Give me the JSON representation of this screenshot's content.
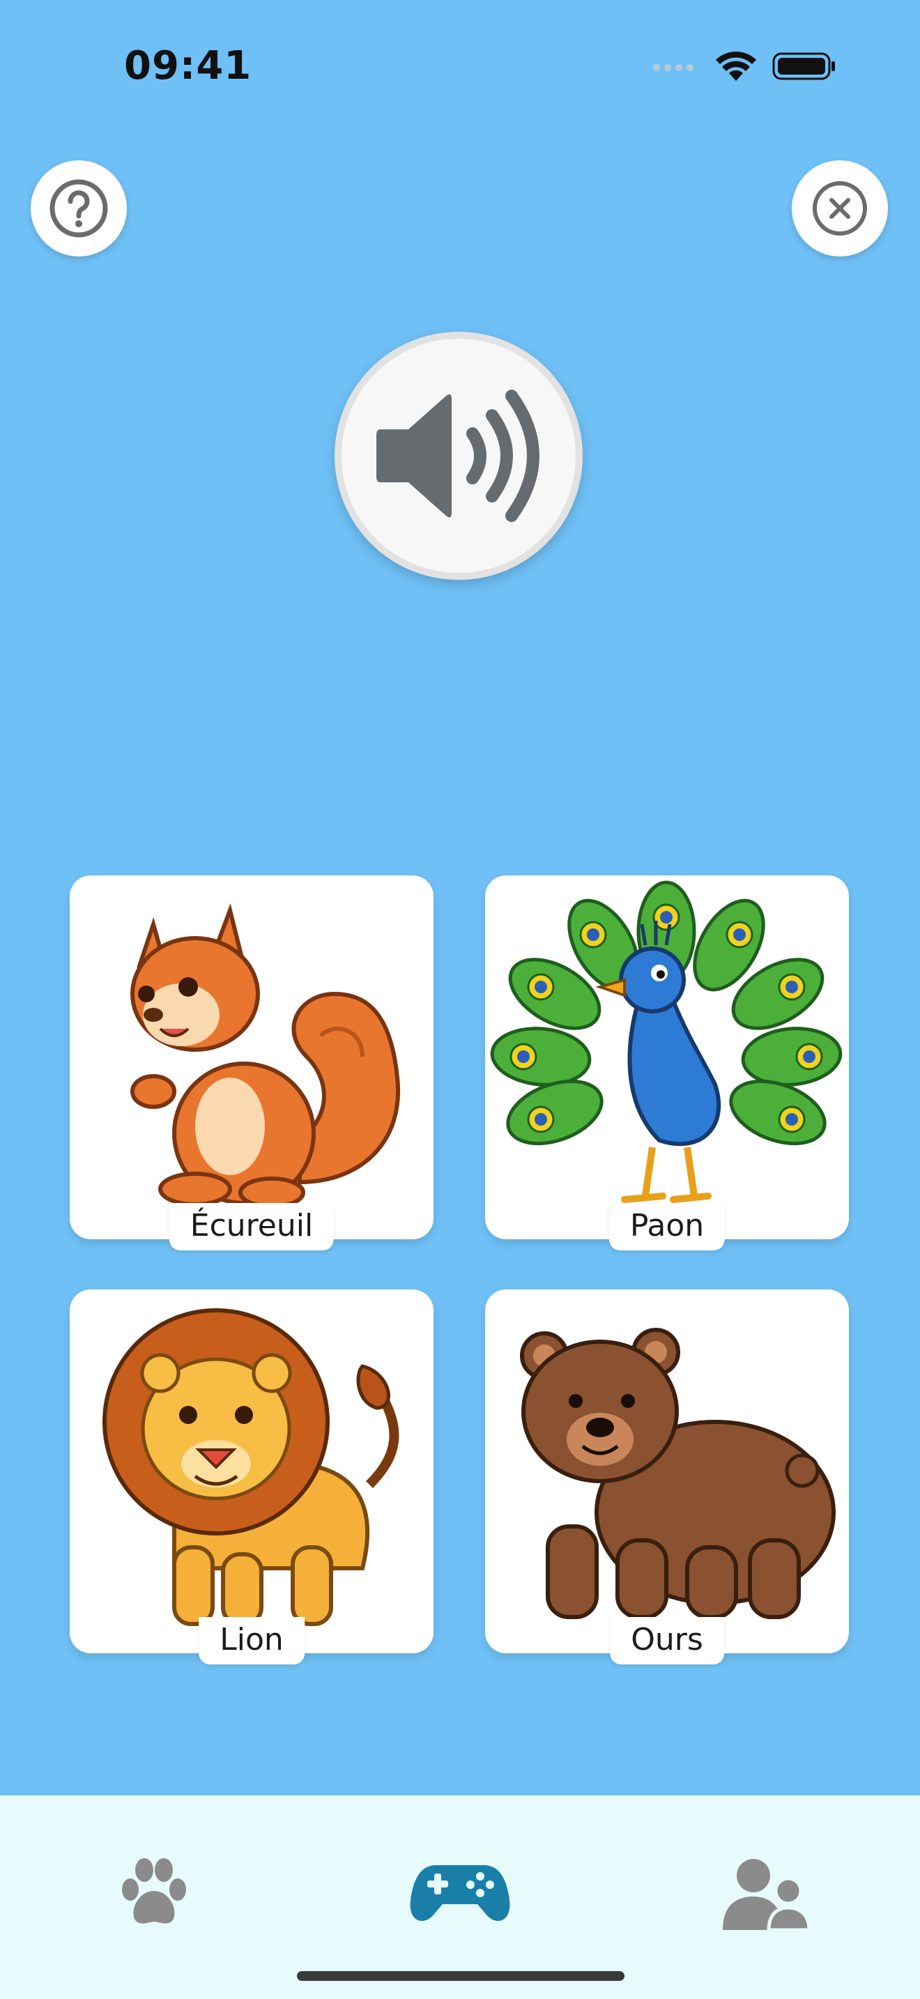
{
  "status": {
    "time": "09:41"
  },
  "header": {
    "help_icon": "question-circle-icon",
    "close_icon": "close-circle-icon"
  },
  "sound": {
    "icon": "speaker-wave-icon"
  },
  "cards": [
    {
      "label": "Écureuil",
      "image": "squirrel"
    },
    {
      "label": "Paon",
      "image": "peacock"
    },
    {
      "label": "Lion",
      "image": "lion"
    },
    {
      "label": "Ours",
      "image": "bear"
    }
  ],
  "tabs": [
    {
      "icon": "paw-icon",
      "active": false
    },
    {
      "icon": "gamepad-icon",
      "active": true
    },
    {
      "icon": "profiles-icon",
      "active": false
    }
  ],
  "colors": {
    "background": "#6fc0f6",
    "tab_bar": "#e8fbfc",
    "active_tab": "#1a7fa8",
    "inactive_tab": "#8b8b8b"
  }
}
